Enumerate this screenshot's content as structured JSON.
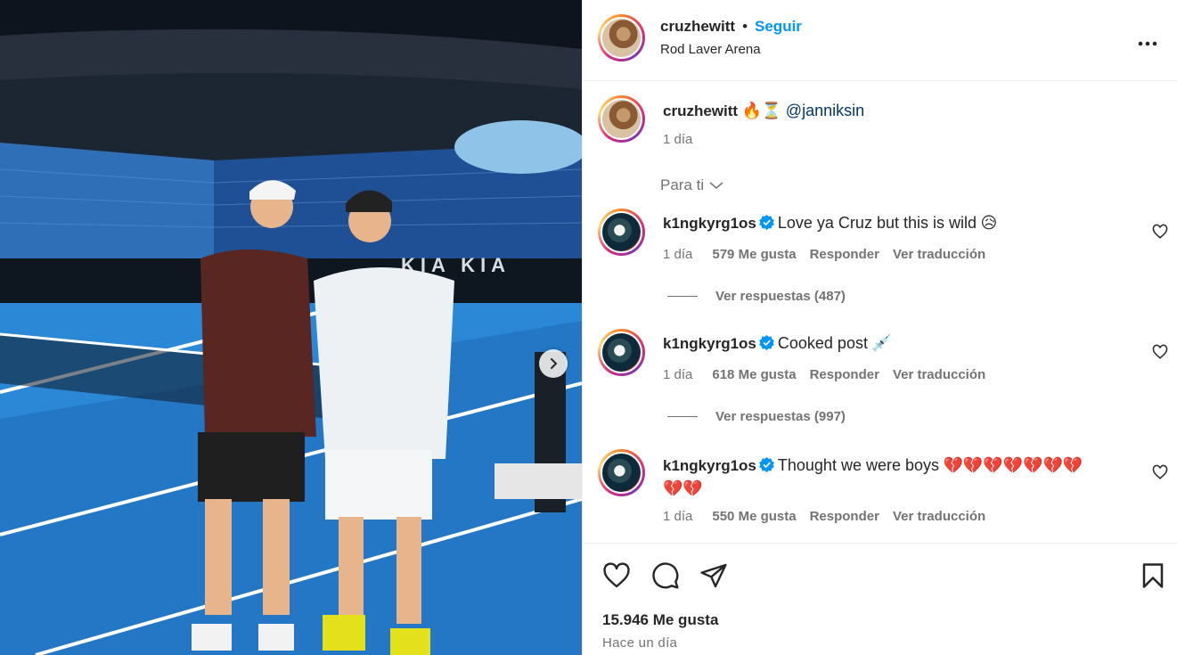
{
  "post": {
    "author": "cruzhewitt",
    "separator": "•",
    "follow_label": "Seguir",
    "location": "Rod Laver Arena",
    "more_label": "•••"
  },
  "caption": {
    "author": "cruzhewitt",
    "emojis": "🔥⏳",
    "mention": "@janniksin",
    "time": "1 día"
  },
  "filter": {
    "label": "Para ti"
  },
  "comments": [
    {
      "author": "k1ngkyrg1os",
      "text": "Love ya Cruz but this is wild",
      "emoji": "😥",
      "time": "1 día",
      "likes": "579 Me gusta",
      "reply": "Responder",
      "translate": "Ver traducción",
      "replies": "Ver respuestas (487)"
    },
    {
      "author": "k1ngkyrg1os",
      "text": "Cooked post",
      "emoji": "💉",
      "time": "1 día",
      "likes": "618 Me gusta",
      "reply": "Responder",
      "translate": "Ver traducción",
      "replies": "Ver respuestas (997)"
    },
    {
      "author": "k1ngkyrg1os",
      "text": "Thought we were boys",
      "emoji": "💔💔💔💔💔💔💔",
      "emoji2": "💔💔",
      "time": "1 día",
      "likes": "550 Me gusta",
      "reply": "Responder",
      "translate": "Ver traducción"
    }
  ],
  "footer": {
    "likes": "15.946 Me gusta",
    "time": "Hace un día"
  },
  "icons": {
    "like": "heart-icon",
    "comment": "comment-icon",
    "share": "send-icon",
    "save": "bookmark-icon",
    "next": "chevron-right-icon",
    "verified": "verified-badge-icon"
  },
  "colors": {
    "link": "#0095f6",
    "mention": "#00376b",
    "verified": "#0095f6",
    "muted": "#737373"
  }
}
